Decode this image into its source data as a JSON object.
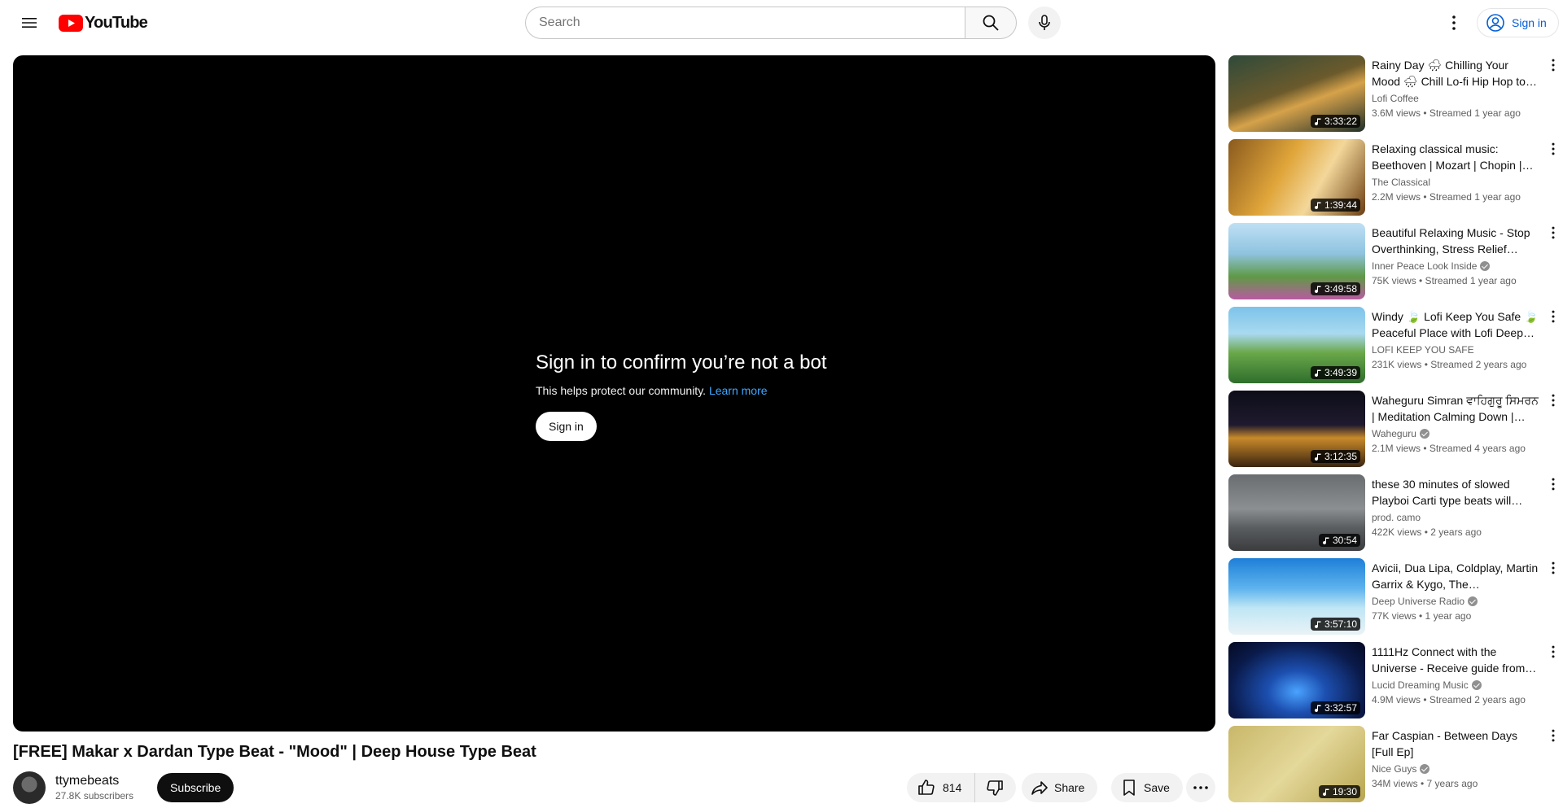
{
  "header": {
    "logo_text": "YouTube",
    "search_placeholder": "Search",
    "signin_label": "Sign in"
  },
  "player": {
    "bot_title": "Sign in to confirm you’re not a bot",
    "bot_sub": "This helps protect our community.",
    "learn_more": "Learn more",
    "signin_label": "Sign in"
  },
  "video": {
    "title": "[FREE] Makar x Dardan Type Beat - \"Mood\" | Deep House Type Beat",
    "channel": "ttymebeats",
    "subscribers": "27.8K subscribers",
    "subscribe_label": "Subscribe",
    "likes": "814",
    "share_label": "Share",
    "save_label": "Save"
  },
  "colors": {
    "brand_red": "#ff0000",
    "link_blue": "#065fd4"
  },
  "recommendations": [
    {
      "title": "Rainy Day 🌧 Chilling Your Mood 🌧 Chill Lo-fi Hip Hop to Study / Relax",
      "channel": "Lofi Coffee",
      "verified": false,
      "meta": "3.6M views • Streamed 1 year ago",
      "duration": "3:33:22",
      "thumb_bg": "linear-gradient(160deg,#2f4a3a 0%,#6b5a2c 45%,#d6a24a 60%,#1f2e2a 100%)"
    },
    {
      "title": "Relaxing classical music: Beethoven | Mozart | Chopin | Bach",
      "channel": "The Classical",
      "verified": false,
      "meta": "2.2M views • Streamed 1 year ago",
      "duration": "1:39:44",
      "thumb_bg": "linear-gradient(120deg,#8a5a1e 0%,#e0a53a 40%,#f3d79a 65%,#6b3e12 100%)"
    },
    {
      "title": "Beautiful Relaxing Music - Stop Overthinking, Stress Relief Music",
      "channel": "Inner Peace Look Inside",
      "verified": true,
      "meta": "75K views • Streamed 1 year ago",
      "duration": "3:49:58",
      "thumb_bg": "linear-gradient(180deg,#bfe0f5 0%,#8fc3e0 40%,#5f9a46 70%,#b85aa0 100%)"
    },
    {
      "title": "Windy 🍃 Lofi Keep You Safe 🍃 Peaceful Place with Lofi Deep Focus",
      "channel": "LOFI KEEP YOU SAFE",
      "verified": false,
      "meta": "231K views • Streamed 2 years ago",
      "duration": "3:49:39",
      "thumb_bg": "linear-gradient(180deg,#7cc3ea 0%,#a9d9f0 35%,#6aa84a 60%,#2f6e2c 100%)"
    },
    {
      "title": "Waheguru Simran ਵਾਹਿਗੁਰੂ ਸਿਮਰਨ | Meditation Calming Down | Relaxing Music",
      "channel": "Waheguru",
      "verified": true,
      "meta": "2.1M views • Streamed 4 years ago",
      "duration": "3:12:35",
      "thumb_bg": "linear-gradient(180deg,#0d0d18 0%,#1f1a2e 45%,#c88a2a 62%,#3a2410 100%)"
    },
    {
      "title": "these 30 minutes of slowed Playboi Carti type beats will change your life",
      "channel": "prod. camo",
      "verified": false,
      "meta": "422K views • 2 years ago",
      "duration": "30:54",
      "thumb_bg": "linear-gradient(180deg,#6a6d70 0%,#8c8f92 45%,#5a5d60 70%,#3a3c3e 100%)"
    },
    {
      "title": "Avicii, Dua Lipa, Coldplay, Martin Garrix & Kygo, The Chainsmokers Style",
      "channel": "Deep Universe Radio",
      "verified": true,
      "meta": "77K views • 1 year ago",
      "duration": "3:57:10",
      "thumb_bg": "linear-gradient(180deg,#1e7fd8 0%,#5fb4ee 40%,#bfe6f5 65%,#e9f3f6 100%)"
    },
    {
      "title": "1111Hz Connect with the Universe - Receive guide from the Universe",
      "channel": "Lucid Dreaming Music",
      "verified": true,
      "meta": "4.9M views • Streamed 2 years ago",
      "duration": "3:32:57",
      "thumb_bg": "radial-gradient(ellipse at 50% 65%,#4aa3ff 0%,#1c4fb0 30%,#0a1a4a 70%,#050a22 100%)"
    },
    {
      "title": "Far Caspian - Between Days [Full Ep]",
      "channel": "Nice Guys",
      "verified": true,
      "meta": "34M views • 7 years ago",
      "duration": "19:30",
      "thumb_bg": "linear-gradient(135deg,#c9b86a 0%,#e4d89a 50%,#b8a550 100%)"
    }
  ]
}
